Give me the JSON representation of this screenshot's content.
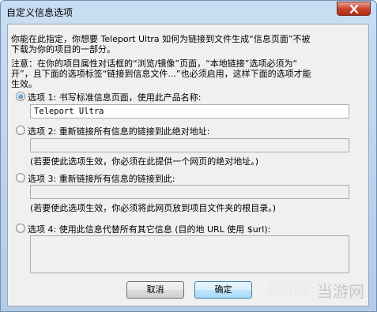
{
  "window": {
    "title": "自定义信息选项"
  },
  "intro": {
    "line1": "你能在此指定，你想要 Teleport Ultra 如何为链接到文件生成“信息页面”不被",
    "line2": "下载为你的项目的一部分。"
  },
  "note": {
    "line1": "注意：在你的项目属性对话框的“浏览/镜像”页面，“本地链接”选项必须为“",
    "line2": "开”，且下面的选项标签“链接到信息文件...”也必须启用，这样下面的选项才能",
    "line3": "生效。"
  },
  "options": [
    {
      "label": "选项 1:  书写标准信息页面，使用此产品名称:",
      "checked": true,
      "value": "Teleport Ultra"
    },
    {
      "label": "选项 2:  重新链接所有信息的链接到此绝对地址:",
      "checked": false,
      "value": "",
      "hint": "(若要使此选项生效，你必须在此提供一个网页的绝对地址。)"
    },
    {
      "label": "选项 3:  重新链接所有信息的链接到此:",
      "checked": false,
      "value": "",
      "hint": "(若要使此选项生效，你必须将此网页放到项目文件夹的根目录。)"
    },
    {
      "label": "选项 4:  使用此信息代替所有其它信息 (目的地 URL 使用 $url):",
      "checked": false,
      "value": ""
    }
  ],
  "buttons": {
    "cancel": "取消",
    "ok": "确定"
  },
  "watermark": {
    "logo": "3HE",
    "text": "当游网"
  },
  "icons": {
    "close": "close-icon",
    "radio_checked": "radio-checked-icon",
    "radio_unchecked": "radio-unchecked-icon"
  }
}
